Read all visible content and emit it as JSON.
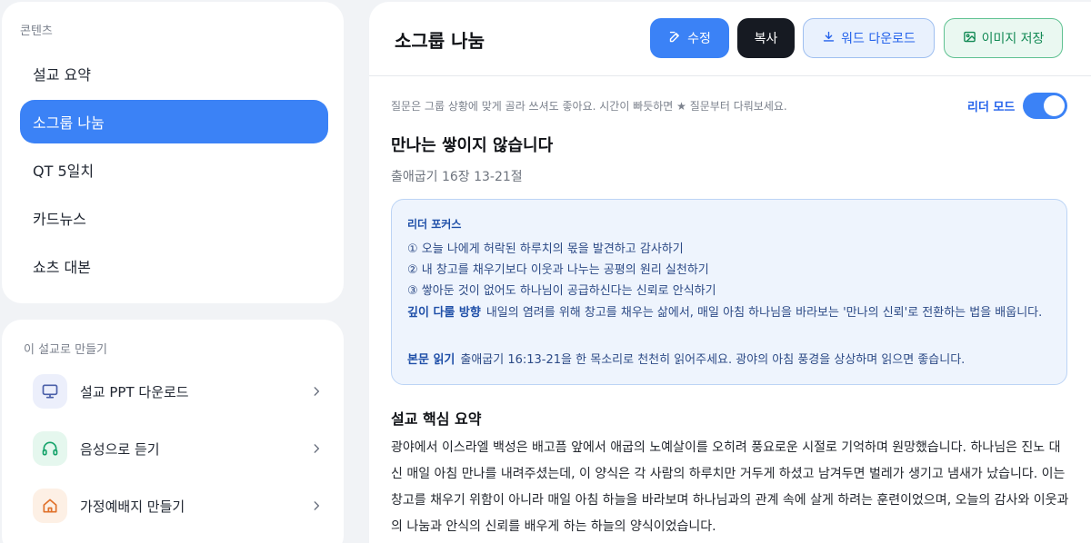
{
  "nav": {
    "heading": "콘텐츠",
    "items": [
      {
        "label": "설교 요약",
        "active": false
      },
      {
        "label": "소그룹 나눔",
        "active": true
      },
      {
        "label": "QT 5일치",
        "active": false
      },
      {
        "label": "카드뉴스",
        "active": false
      },
      {
        "label": "쇼츠 대본",
        "active": false
      }
    ]
  },
  "make": {
    "heading": "이 설교로 만들기",
    "items": [
      {
        "label": "설교 PPT 다운로드",
        "icon": "monitor-icon",
        "color": "#4a5fa8",
        "bg": "#eceffb"
      },
      {
        "label": "음성으로 듣기",
        "icon": "headphones-icon",
        "color": "#15a36a",
        "bg": "#e5f7ee"
      },
      {
        "label": "가정예배지 만들기",
        "icon": "home-icon",
        "color": "#e0712a",
        "bg": "#fdf0e5"
      }
    ]
  },
  "header": {
    "title": "소그룹 나눔",
    "buttons": {
      "edit": "수정",
      "copy": "복사",
      "word": "워드 다운로드",
      "image": "이미지 저장"
    }
  },
  "content": {
    "hint": "질문은 그룹 상황에 맞게 골라 쓰셔도 좋아요. 시간이 빠듯하면 ★ 질문부터 다뤄보세요.",
    "leader_mode_label": "리더 모드",
    "leader_mode_on": true,
    "sermon_title": "만나는 쌓이지 않습니다",
    "scripture": "출애굽기 16장 13-21절",
    "focus": {
      "title": "리더 포커스",
      "points": [
        "① 오늘 나에게 허락된 하루치의 몫을 발견하고 감사하기",
        "② 내 창고를 채우기보다 이웃과 나누는 공평의 원리 실천하기",
        "③ 쌓아둔 것이 없어도 하나님이 공급하신다는 신뢰로 안식하기"
      ],
      "direction_label": "깊이 다룰 방향",
      "direction_text": "내일의 염려를 위해 창고를 채우는 삶에서, 매일 아침 하나님을 바라보는 '만나의 신뢰'로 전환하는 법을 배웁니다.",
      "reading_label": "본문 읽기",
      "reading_text": "출애굽기 16:13-21을 한 목소리로 천천히 읽어주세요. 광야의 아침 풍경을 상상하며 읽으면 좋습니다."
    },
    "summary_title": "설교 핵심 요약",
    "summary_text": "광야에서 이스라엘 백성은 배고픔 앞에서 애굽의 노예살이를 오히려 풍요로운 시절로 기억하며 원망했습니다. 하나님은 진노 대신 매일 아침 만나를 내려주셨는데, 이 양식은 각 사람의 하루치만 거두게 하셨고 남겨두면 벌레가 생기고 냄새가 났습니다. 이는 창고를 채우기 위함이 아니라 매일 아침 하늘을 바라보며 하나님과의 관계 속에 살게 하려는 훈련이었으며, 오늘의 감사와 이웃과의 나눔과 안식의 신뢰를 배우게 하는 하늘의 양식이었습니다."
  }
}
